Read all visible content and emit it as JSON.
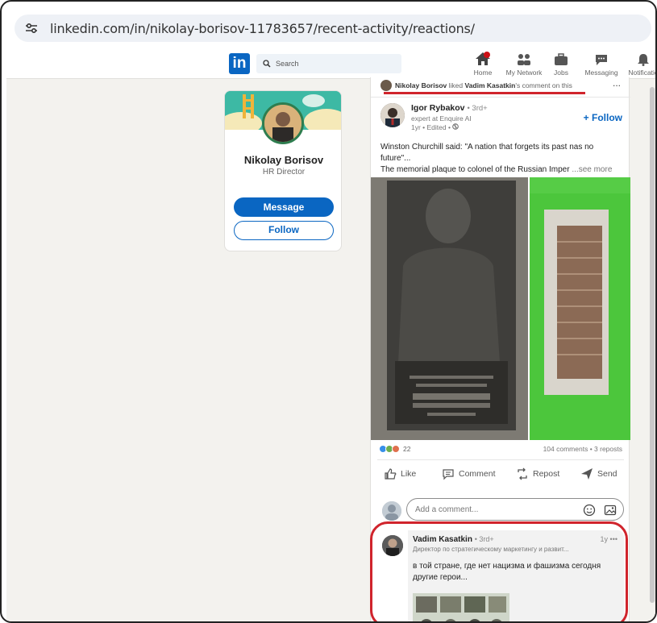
{
  "browser": {
    "url": "linkedin.com/in/nikolay-borisov-11783657/recent-activity/reactions/",
    "site_icon": "tune-icon"
  },
  "nav": {
    "logo": "in",
    "search_placeholder": "Search",
    "items": [
      {
        "label": "Home",
        "icon": "home-icon"
      },
      {
        "label": "My Network",
        "icon": "network-icon"
      },
      {
        "label": "Jobs",
        "icon": "briefcase-icon"
      },
      {
        "label": "Messaging",
        "icon": "messaging-icon"
      },
      {
        "label": "Notificatio",
        "icon": "bell-icon"
      }
    ]
  },
  "profile": {
    "name": "Nikolay Borisov",
    "title": "HR Director",
    "message_label": "Message",
    "follow_label": "Follow"
  },
  "activity": {
    "actor": "Nikolay Borisov",
    "verb": "liked",
    "target": "Vadim Kasatkin",
    "tail": "'s comment on this",
    "more": "..."
  },
  "post": {
    "author": "Igor Rybakov",
    "degree": "• 3rd+",
    "headline": "expert at Enquire AI",
    "time": "1yr • Edited •",
    "follow_label": "+ Follow",
    "text_line1": "Winston Churchill said: \"A nation that forgets its past nas no",
    "text_line2": "future\"...",
    "text_line3": "The memorial plaque to colonel of the Russian Imper",
    "see_more": "...see more",
    "reaction_count": "22",
    "comments_reposts": "104 comments • 3 reposts",
    "actions": {
      "like": "Like",
      "comment": "Comment",
      "repost": "Repost",
      "send": "Send"
    },
    "add_comment_placeholder": "Add a comment..."
  },
  "comment": {
    "author": "Vadim Kasatkin",
    "degree": "• 3rd+",
    "time": "1y",
    "more": "•••",
    "headline": "Директор по стратегическому маркетингу и развит...",
    "text_line1": "в той стране, где нет нацизма и фашизма сегодня",
    "text_line2": "другие герои..."
  },
  "colors": {
    "linkedin_blue": "#0a66c2",
    "highlight_red": "#d0242c",
    "feed_bg": "#f3f2ee"
  }
}
